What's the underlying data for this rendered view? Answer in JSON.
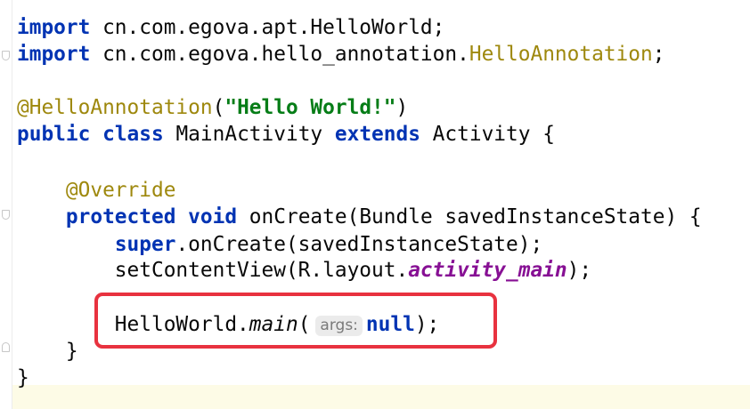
{
  "editor": {
    "lines": [
      {
        "segments": [
          {
            "t": "import",
            "c": "kw"
          },
          {
            "t": " cn.com.egova.apt.HelloWorld;"
          }
        ]
      },
      {
        "segments": [
          {
            "t": "import",
            "c": "kw"
          },
          {
            "t": " cn.com.egova.hello_annotation."
          },
          {
            "t": "HelloAnnotation",
            "c": "ann"
          },
          {
            "t": ";"
          }
        ]
      },
      {
        "segments": []
      },
      {
        "segments": [
          {
            "t": "@HelloAnnotation",
            "c": "ann"
          },
          {
            "t": "("
          },
          {
            "t": "\"Hello World!\"",
            "c": "str"
          },
          {
            "t": ")"
          }
        ]
      },
      {
        "segments": [
          {
            "t": "public",
            "c": "kw"
          },
          {
            "t": " "
          },
          {
            "t": "class",
            "c": "kw"
          },
          {
            "t": " MainActivity "
          },
          {
            "t": "extends",
            "c": "kw"
          },
          {
            "t": " Activity {"
          }
        ]
      },
      {
        "segments": []
      },
      {
        "segments": [
          {
            "t": "    "
          },
          {
            "t": "@Override",
            "c": "ann"
          }
        ]
      },
      {
        "segments": [
          {
            "t": "    "
          },
          {
            "t": "protected",
            "c": "kw"
          },
          {
            "t": " "
          },
          {
            "t": "void",
            "c": "kw"
          },
          {
            "t": " onCreate(Bundle savedInstanceState) {"
          }
        ]
      },
      {
        "segments": [
          {
            "t": "        "
          },
          {
            "t": "super",
            "c": "kw"
          },
          {
            "t": ".onCreate(savedInstanceState);"
          }
        ]
      },
      {
        "segments": [
          {
            "t": "        setContentView(R.layout."
          },
          {
            "t": "activity_main",
            "c": "field"
          },
          {
            "t": ");"
          }
        ]
      },
      {
        "segments": []
      },
      {
        "segments": [
          {
            "t": "        HelloWorld."
          },
          {
            "t": "main",
            "c": "static-call"
          },
          {
            "t": "("
          },
          {
            "t": "args:",
            "c": "hint"
          },
          {
            "t": "null",
            "c": "kw"
          },
          {
            "t": ");"
          }
        ]
      },
      {
        "segments": [
          {
            "t": "    }"
          }
        ]
      },
      {
        "segments": [
          {
            "t": "}"
          }
        ]
      }
    ]
  },
  "colors": {
    "keyword": "#0033b3",
    "annotation": "#9e880d",
    "string": "#067d17",
    "field": "#871094",
    "highlight_border": "#e8323f",
    "caret_line": "#fdfbe6"
  }
}
